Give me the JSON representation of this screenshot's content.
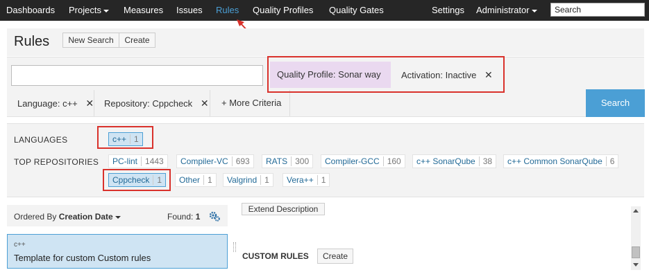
{
  "nav": {
    "items": [
      "Dashboards",
      "Projects",
      "Measures",
      "Issues",
      "Rules",
      "Quality Profiles",
      "Quality Gates"
    ],
    "settings": "Settings",
    "admin": "Administrator",
    "search_placeholder": "Search"
  },
  "header": {
    "title": "Rules",
    "new_search": "New Search",
    "create": "Create"
  },
  "filters": {
    "query_value": "",
    "quality_profile_label": "Quality Profile:",
    "quality_profile_value": "Sonar way",
    "activation_label": "Activation:",
    "activation_value": "Inactive",
    "language_label": "Language:",
    "language_value": "c++",
    "repository_label": "Repository:",
    "repository_value": "Cppcheck",
    "more_criteria": "+ More Criteria",
    "search_button": "Search",
    "remove_glyph": "✕"
  },
  "facets": {
    "languages_label": "LANGUAGES",
    "languages": [
      {
        "name": "c++",
        "count": "1",
        "selected": true
      }
    ],
    "repositories_label": "TOP REPOSITORIES",
    "repositories": [
      {
        "name": "PC-lint",
        "count": "1443"
      },
      {
        "name": "Compiler-VC",
        "count": "693"
      },
      {
        "name": "RATS",
        "count": "300"
      },
      {
        "name": "Compiler-GCC",
        "count": "160"
      },
      {
        "name": "c++ SonarQube",
        "count": "38"
      },
      {
        "name": "c++ Common SonarQube",
        "count": "6"
      },
      {
        "name": "Cppcheck",
        "count": "1",
        "selected": true
      },
      {
        "name": "Other",
        "count": "1"
      },
      {
        "name": "Valgrind",
        "count": "1"
      },
      {
        "name": "Vera++",
        "count": "1"
      }
    ]
  },
  "list": {
    "ordered_by": "Ordered By",
    "order_field": "Creation Date",
    "found_label": "Found:",
    "found_count": "1",
    "rule": {
      "language": "c++",
      "name": "Template for custom Custom rules"
    }
  },
  "details": {
    "extend_description": "Extend Description",
    "custom_rules_label": "CUSTOM RULES",
    "create": "Create"
  },
  "colors": {
    "navbar": "#262626",
    "accent": "#4b9fd5",
    "annotation": "#d9312b",
    "profile_bg": "#ead9f0"
  }
}
